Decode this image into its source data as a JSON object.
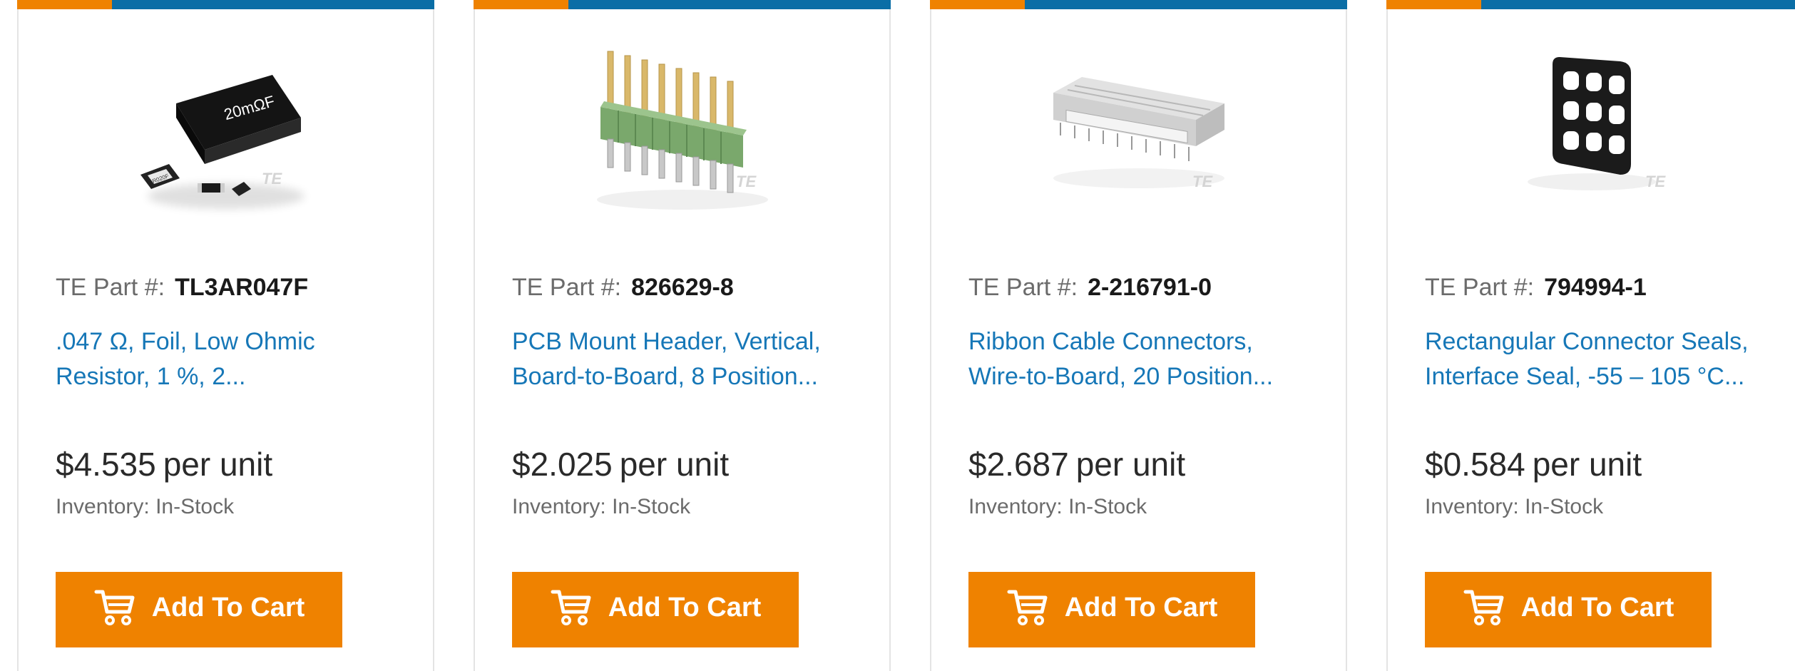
{
  "colors": {
    "accent_orange": "#ef8200",
    "brand_blue": "#0b6ea6",
    "link_blue": "#1677b7"
  },
  "products": [
    {
      "image_icon": "resistor-image",
      "image_marks": [
        "20mΩF",
        "R020F"
      ],
      "part_label": "TE Part #:",
      "part_number": "TL3AR047F",
      "description_line1": ".047 Ω, Foil, Low Ohmic",
      "description_line2": "Resistor, 1 %, 2...",
      "price": "$4.535",
      "price_suffix": "per unit",
      "inventory": "Inventory: In-Stock",
      "button_label": "Add To Cart"
    },
    {
      "image_icon": "pin-header-image",
      "image_marks": [],
      "part_label": "TE Part #:",
      "part_number": "826629-8",
      "description_line1": "PCB Mount Header, Vertical,",
      "description_line2": "Board-to-Board, 8 Position...",
      "price": "$2.025",
      "price_suffix": "per unit",
      "inventory": "Inventory: In-Stock",
      "button_label": "Add To Cart"
    },
    {
      "image_icon": "ribbon-connector-image",
      "image_marks": [],
      "part_label": "TE Part #:",
      "part_number": "2-216791-0",
      "description_line1": "Ribbon Cable Connectors,",
      "description_line2": "Wire-to-Board, 20 Position...",
      "price": "$2.687",
      "price_suffix": "per unit",
      "inventory": "Inventory: In-Stock",
      "button_label": "Add To Cart"
    },
    {
      "image_icon": "connector-seal-image",
      "image_marks": [],
      "part_label": "TE Part #:",
      "part_number": "794994-1",
      "description_line1": "Rectangular Connector Seals,",
      "description_line2": "Interface Seal, -55 – 105 °C...",
      "price": "$0.584",
      "price_suffix": "per unit",
      "inventory": "Inventory: In-Stock",
      "button_label": "Add To Cart"
    }
  ],
  "watermark": "TE"
}
